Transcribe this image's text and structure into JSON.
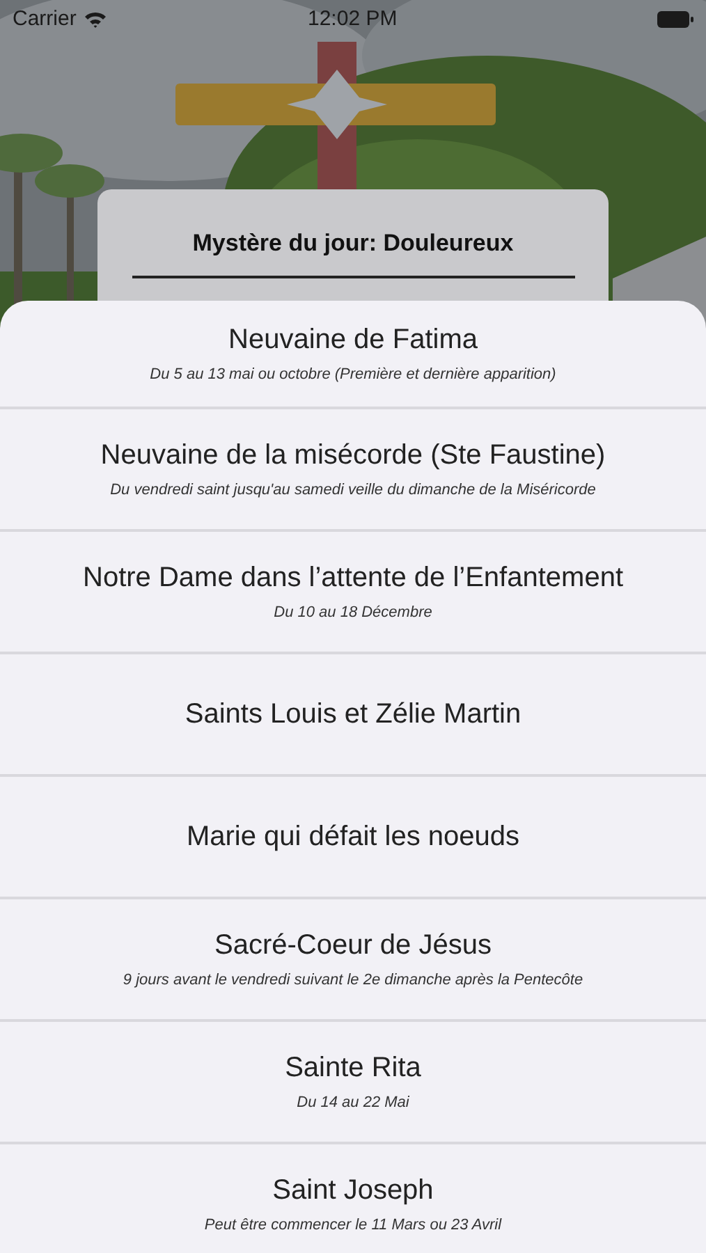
{
  "status_bar": {
    "carrier": "Carrier",
    "time": "12:02 PM"
  },
  "card": {
    "title": "Mystère du jour: Douleureux"
  },
  "sheet": {
    "items": [
      {
        "title": "Neuvaine de Fatima",
        "subtitle": "Du 5 au 13 mai ou octobre (Première et dernière apparition)"
      },
      {
        "title": "Neuvaine de la misécorde (Ste Faustine)",
        "subtitle": "Du vendredi saint jusqu'au samedi veille du dimanche de la Miséricorde"
      },
      {
        "title": "Notre Dame dans l’attente de l’Enfantement",
        "subtitle": "Du 10 au 18 Décembre"
      },
      {
        "title": "Saints Louis et Zélie Martin"
      },
      {
        "title": "Marie qui défait les noeuds"
      },
      {
        "title": "Sacré-Coeur de Jésus",
        "subtitle": "9 jours avant le vendredi suivant le 2e dimanche après la Pentecôte"
      },
      {
        "title": "Sainte Rita",
        "subtitle": "Du 14 au 22 Mai"
      },
      {
        "title": "Saint Joseph",
        "subtitle": "Peut être commencer le 11 Mars ou 23 Avril"
      }
    ]
  }
}
